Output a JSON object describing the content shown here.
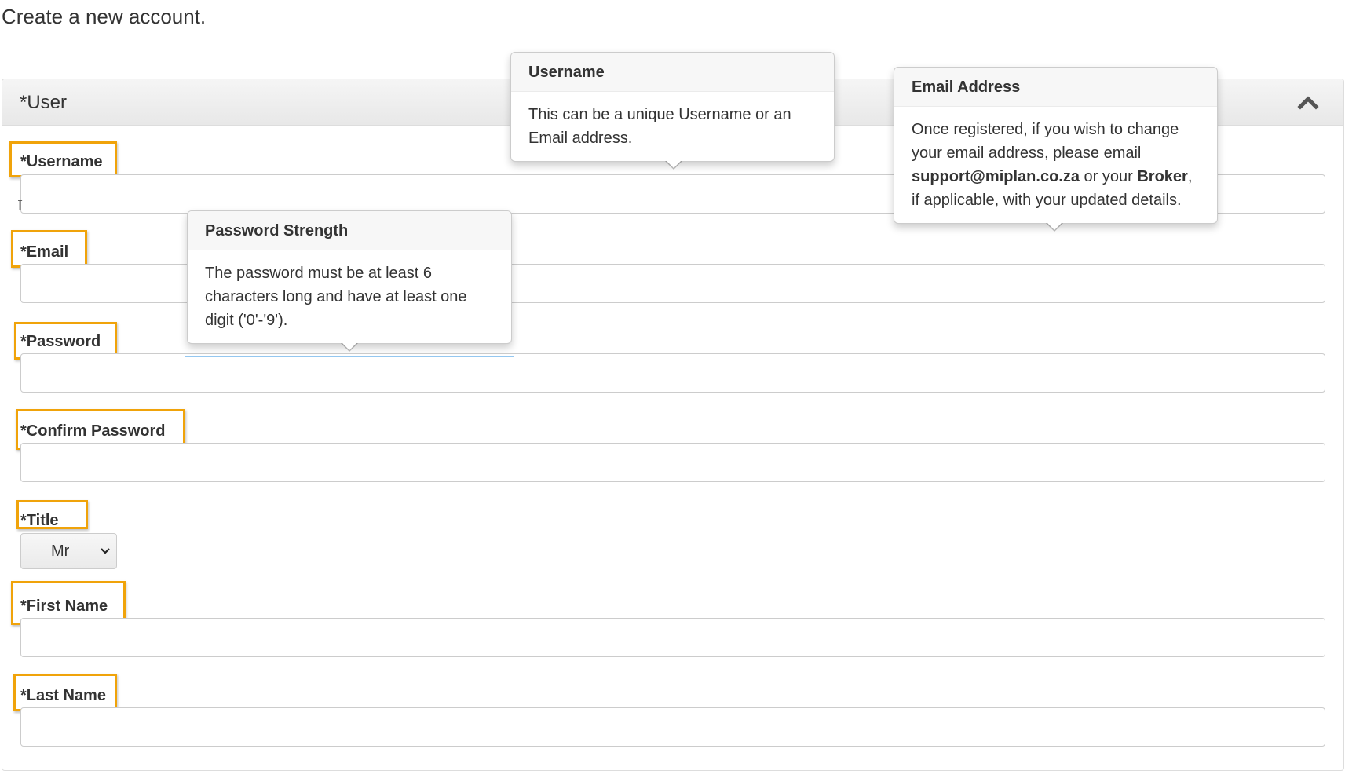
{
  "page": {
    "heading": "Create a new account."
  },
  "panel": {
    "title": "*User",
    "collapse_icon": "chevron-up-icon"
  },
  "fields": {
    "username": {
      "label": "*Username",
      "value": ""
    },
    "email": {
      "label": "*Email",
      "value": ""
    },
    "password": {
      "label": "*Password",
      "value": ""
    },
    "confirm_password": {
      "label": "*Confirm Password",
      "value": ""
    },
    "title": {
      "label": "*Title",
      "selected": "Mr",
      "icon": "chevron-down-icon"
    },
    "first_name": {
      "label": "*First Name",
      "value": ""
    },
    "last_name": {
      "label": "*Last Name",
      "value": ""
    }
  },
  "popovers": {
    "username": {
      "title": "Username",
      "content": "This can be a unique Username or an Email address."
    },
    "email": {
      "title": "Email Address",
      "text_1": "Once registered, if you wish to change your email address, please email",
      "email_bold": "support@miplan.co.za",
      "text_2": "or your",
      "broker_bold": "Broker",
      "text_3": ", if applicable, with your updated details."
    },
    "password": {
      "title": "Password Strength",
      "content": "The password must be at least 6 characters long and have at least one digit ('0'-'9')."
    }
  },
  "colors": {
    "highlight": "#f0a30a",
    "focus": "#66afe9",
    "text": "#333333",
    "border": "#cccccc"
  }
}
